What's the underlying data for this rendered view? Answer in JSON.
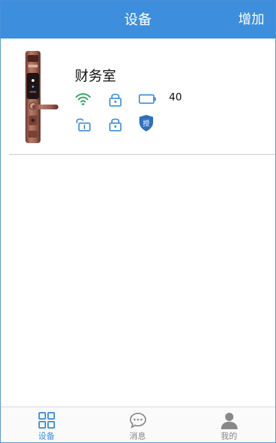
{
  "header": {
    "title": "设备",
    "add_label": "增加"
  },
  "device": {
    "name": "财务室",
    "battery_value": "40",
    "badge_label": "授",
    "icons": [
      "wifi-icon",
      "lock-icon",
      "battery-icon",
      "unlock-icon",
      "lock-icon",
      "authorized-shield-icon"
    ]
  },
  "tabbar": {
    "tabs": [
      {
        "label": "设备",
        "icon": "grid-icon",
        "active": true
      },
      {
        "label": "消息",
        "icon": "chat-bubble-icon",
        "active": false
      },
      {
        "label": "我的",
        "icon": "user-icon",
        "active": false
      }
    ]
  },
  "colors": {
    "header_bg": "#3d8fde",
    "icon_blue": "#3d8fde",
    "wifi_green": "#22a65a",
    "shield_blue": "#2f6fc0",
    "tab_inactive": "#888888",
    "lock_bronze": "#8e5548"
  }
}
